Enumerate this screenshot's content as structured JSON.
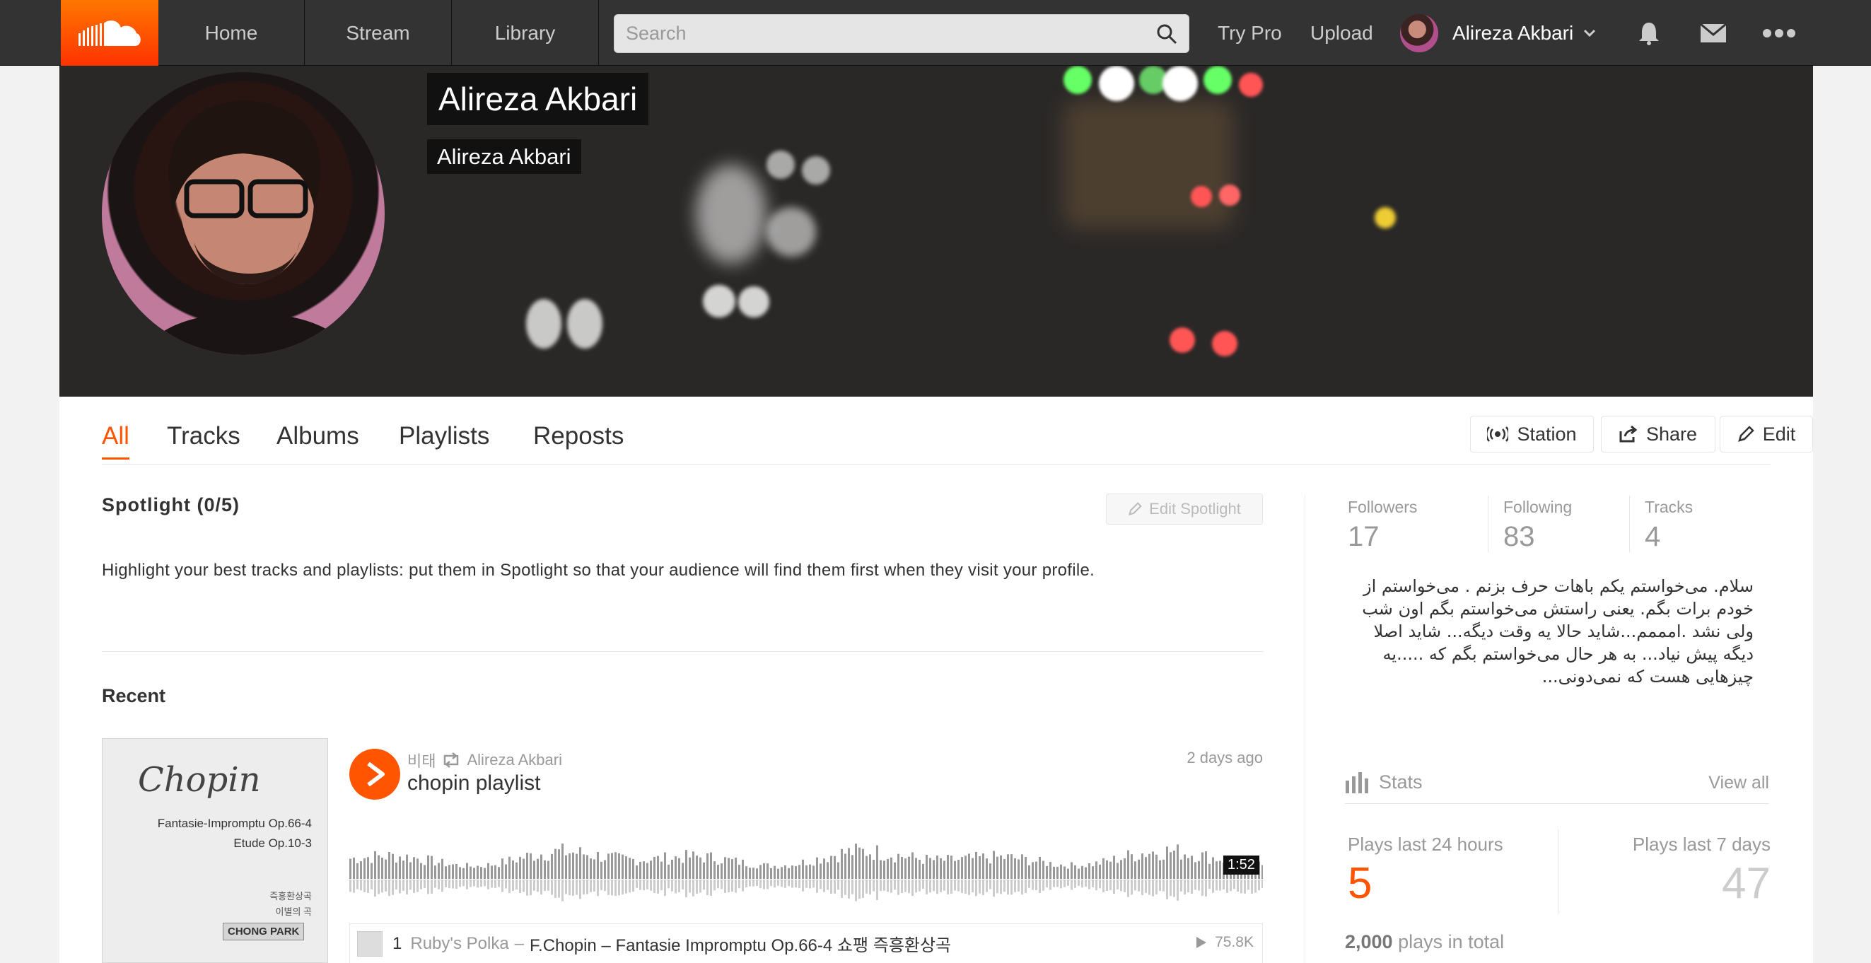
{
  "header": {
    "nav": [
      "Home",
      "Stream",
      "Library"
    ],
    "search_placeholder": "Search",
    "try_pro": "Try Pro",
    "upload": "Upload",
    "username": "Alireza Akbari",
    "colors": {
      "bar": "#333333",
      "accent": "#ff5500"
    }
  },
  "banner": {
    "name": "Alireza Akbari",
    "subname": "Alireza Akbari"
  },
  "tabs": [
    {
      "label": "All",
      "active": true
    },
    {
      "label": "Tracks",
      "active": false
    },
    {
      "label": "Albums",
      "active": false
    },
    {
      "label": "Playlists",
      "active": false
    },
    {
      "label": "Reposts",
      "active": false
    }
  ],
  "actions": {
    "station": "Station",
    "share": "Share",
    "edit": "Edit"
  },
  "spotlight": {
    "title": "Spotlight (0/5)",
    "edit_button": "Edit Spotlight",
    "description": "Highlight your best tracks and playlists: put them in Spotlight so that your audience will find them first when they visit your profile."
  },
  "recent": {
    "title": "Recent",
    "artwork": {
      "title": "Chopin",
      "lines": [
        "Fantasie-Impromptu Op.66-4",
        "Etude  Op.10-3"
      ],
      "korean": [
        "즉흥환상곡",
        "이별의 곡"
      ],
      "label": "CHONG PARK"
    },
    "item": {
      "poster": "비태",
      "reposter": "Alireza Akbari",
      "title": "chopin playlist",
      "time_ago": "2 days ago",
      "duration": "1:52"
    },
    "tracklist": [
      {
        "num": "1",
        "artist": "Ruby's Polka",
        "title": "F.Chopin – Fantasie Impromptu Op.66-4 쇼팽 즉흥환상곡",
        "plays": "75.8K"
      }
    ]
  },
  "sidebar": {
    "stats": [
      {
        "label": "Followers",
        "value": "17"
      },
      {
        "label": "Following",
        "value": "83"
      },
      {
        "label": "Tracks",
        "value": "4"
      }
    ],
    "bio": "سلام. می‌خواستم یکم باهات حرف بزنم . می‌خواستم از خودم برات بگم. یعنی راستش می‌خواستم بگم اون شب ولی نشد .امممم...شاید حالا یه وقت دیگه... شاید اصلا دیگه پیش نیاد... به هر حال می‌خواستم بگم که .....یه چیزهایی هست که نمی‌دونی...",
    "stats_title": "Stats",
    "view_all": "View all",
    "plays_24h_label": "Plays last 24 hours",
    "plays_24h": "5",
    "plays_7d_label": "Plays last 7 days",
    "plays_7d": "47",
    "total_count": "2,000",
    "total_suffix": "plays in total"
  }
}
